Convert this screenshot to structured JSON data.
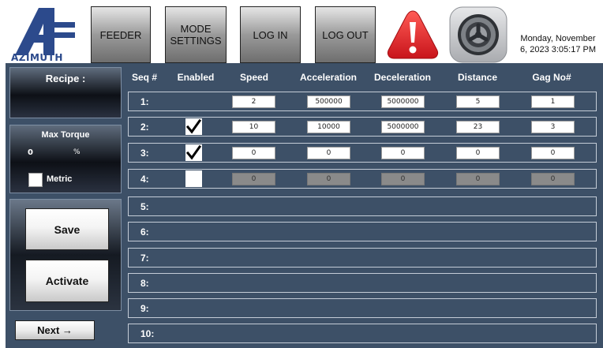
{
  "brand": {
    "name": "AZIMUTH"
  },
  "topbar": {
    "buttons": [
      {
        "label": "FEEDER"
      },
      {
        "label": "MODE\nSETTINGS"
      },
      {
        "label": "LOG IN"
      },
      {
        "label": "LOG OUT"
      }
    ],
    "alert_icon": "warning-exclamation-icon",
    "settings_icon": "gear-icon",
    "datetime": "Monday, November\n6, 2023 3:05:17 PM"
  },
  "sidebar": {
    "recipe_label": "Recipe :",
    "recipe_value": "",
    "max_torque_label": "Max Torque",
    "max_torque_value": "0",
    "max_torque_unit": "%",
    "metric_label": "Metric",
    "metric_checked": false,
    "save_label": "Save",
    "activate_label": "Activate",
    "next_label": "Next →"
  },
  "table": {
    "columns": [
      "Seq #",
      "Enabled",
      "Speed",
      "Acceleration",
      "Deceleration",
      "Distance",
      "Gag No#"
    ],
    "rows": [
      {
        "seq": "1:",
        "has_fields": true,
        "enabled_box": false,
        "enabled": false,
        "disabled": false,
        "values": [
          "2",
          "500000",
          "5000000",
          "5",
          "1"
        ]
      },
      {
        "seq": "2:",
        "has_fields": true,
        "enabled_box": true,
        "enabled": true,
        "disabled": false,
        "values": [
          "10",
          "10000",
          "5000000",
          "23",
          "3"
        ]
      },
      {
        "seq": "3:",
        "has_fields": true,
        "enabled_box": true,
        "enabled": true,
        "disabled": false,
        "values": [
          "0",
          "0",
          "0",
          "0",
          "0"
        ]
      },
      {
        "seq": "4:",
        "has_fields": true,
        "enabled_box": true,
        "enabled": false,
        "disabled": true,
        "values": [
          "0",
          "0",
          "0",
          "0",
          "0"
        ]
      },
      {
        "seq": "5:",
        "has_fields": false
      },
      {
        "seq": "6:",
        "has_fields": false
      },
      {
        "seq": "7:",
        "has_fields": false
      },
      {
        "seq": "8:",
        "has_fields": false
      },
      {
        "seq": "9:",
        "has_fields": false
      },
      {
        "seq": "10:",
        "has_fields": false
      }
    ]
  },
  "colors": {
    "panel": "#3d5067",
    "alert": "#e8232a"
  }
}
